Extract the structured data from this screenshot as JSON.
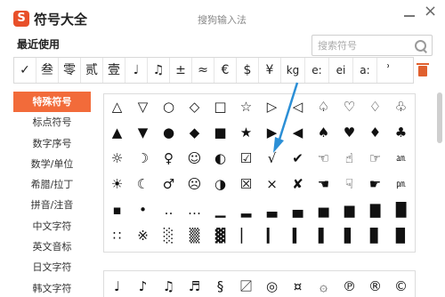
{
  "window": {
    "app_name": "符号大全",
    "title": "搜狗输入法",
    "logo_glyph": "S",
    "accent_color": "#f26b3a"
  },
  "recent": {
    "label": "最近使用",
    "symbols": [
      "✓",
      "叁",
      "零",
      "贰",
      "壹",
      "♩",
      "♫",
      "±",
      "≈",
      "€",
      "$",
      "¥",
      "kg",
      "e:",
      "ei",
      "a:",
      "ʾ"
    ]
  },
  "search": {
    "placeholder": "搜索符号",
    "value": ""
  },
  "sidebar": {
    "items": [
      {
        "label": "特殊符号",
        "active": true
      },
      {
        "label": "标点符号",
        "active": false
      },
      {
        "label": "数字序号",
        "active": false
      },
      {
        "label": "数学/单位",
        "active": false
      },
      {
        "label": "希腊/拉丁",
        "active": false
      },
      {
        "label": "拼音/注音",
        "active": false
      },
      {
        "label": "中文字符",
        "active": false
      },
      {
        "label": "英文音标",
        "active": false
      },
      {
        "label": "日文字符",
        "active": false
      },
      {
        "label": "韩文字符",
        "active": false
      }
    ]
  },
  "symbol_grid": [
    [
      "△",
      "▽",
      "○",
      "◇",
      "□",
      "☆",
      "▷",
      "◁",
      "♤",
      "♡",
      "♢",
      "♧"
    ],
    [
      "▲",
      "▼",
      "●",
      "◆",
      "■",
      "★",
      "▶",
      "◀",
      "♠",
      "♥",
      "♦",
      "♣"
    ],
    [
      "☼",
      "☽",
      "♀",
      "☺",
      "◐",
      "☑",
      "√",
      "✔",
      "☜",
      "☝",
      "☞",
      "㏂"
    ],
    [
      "☀",
      "☾",
      "♂",
      "☹",
      "◑",
      "☒",
      "×",
      "✘",
      "☚",
      "☟",
      "☛",
      "㏘"
    ],
    [
      "▪",
      "•",
      "‥",
      "…",
      "▁",
      "▂",
      "▃",
      "▄",
      "▅",
      "▆",
      "▇",
      "█"
    ],
    [
      "∷",
      "※",
      "░",
      "▒",
      "▓",
      "▏",
      "▎",
      "▍",
      "▌",
      "▋",
      "▊",
      "▉"
    ]
  ],
  "symbol_grid_2": [
    [
      "♩",
      "♪",
      "♫",
      "♬",
      "§",
      "〼",
      "◎",
      "¤",
      "۞",
      "℗",
      "®",
      "©"
    ]
  ]
}
